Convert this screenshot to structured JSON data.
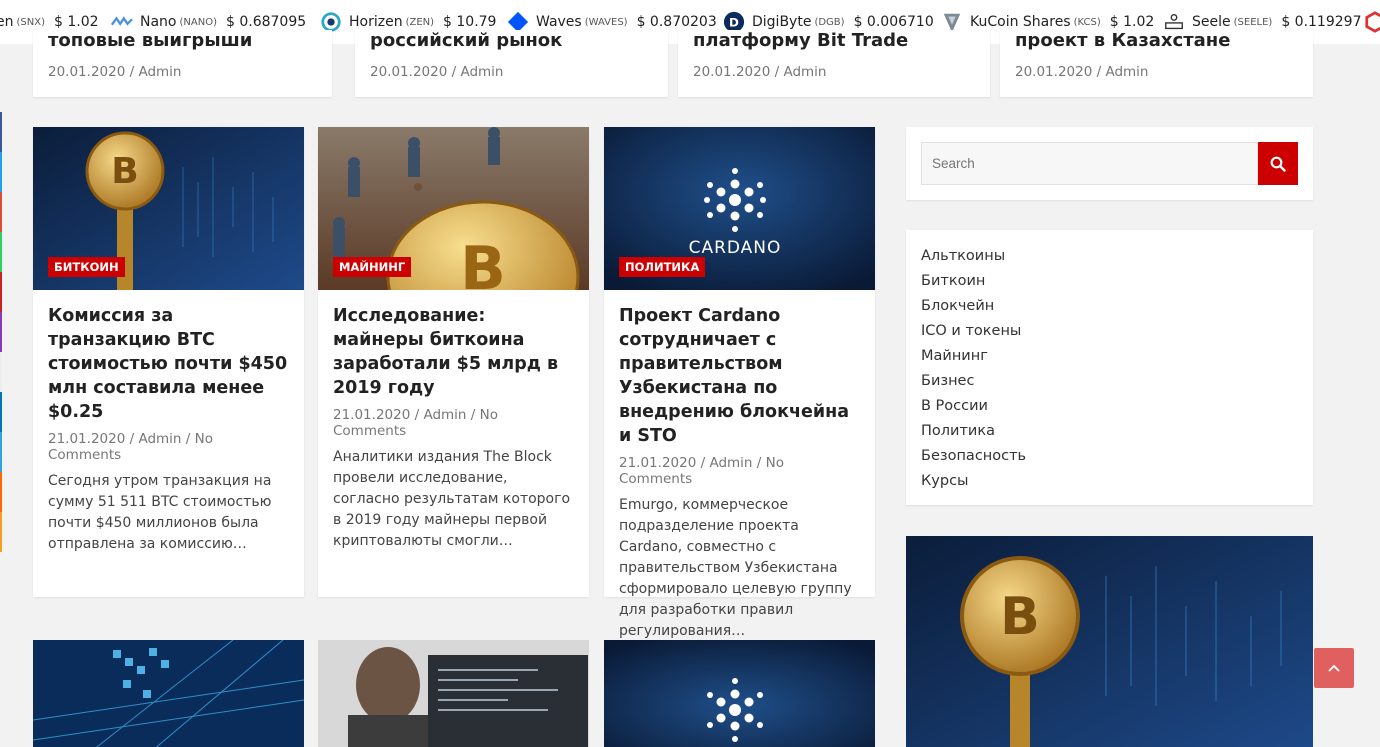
{
  "ticker": [
    {
      "name": "en",
      "symbol": "(SNX)",
      "price": "$ 1.02",
      "icon": "synthetix-icon"
    },
    {
      "name": "Nano",
      "symbol": "(NANO)",
      "price": "$ 0.687095",
      "icon": "nano-icon"
    },
    {
      "name": "Horizen",
      "symbol": "(ZEN)",
      "price": "$ 10.79",
      "icon": "horizen-icon"
    },
    {
      "name": "Waves",
      "symbol": "(WAVES)",
      "price": "$ 0.870203",
      "icon": "waves-icon"
    },
    {
      "name": "DigiByte",
      "symbol": "(DGB)",
      "price": "$ 0.006710",
      "icon": "digibyte-icon"
    },
    {
      "name": "KuCoin Shares",
      "symbol": "(KCS)",
      "price": "$ 1.02",
      "icon": "kucoin-icon"
    },
    {
      "name": "Seele",
      "symbol": "(SEELE)",
      "price": "$ 0.119297",
      "icon": "seele-icon"
    }
  ],
  "top_cards": [
    {
      "title": "топовые выигрыши",
      "date": "20.01.2020",
      "author": "Admin"
    },
    {
      "title": "российский рынок",
      "date": "20.01.2020",
      "author": "Admin"
    },
    {
      "title": "платформу Bit Trade",
      "date": "20.01.2020",
      "author": "Admin"
    },
    {
      "title": "проект в Казахстане",
      "date": "20.01.2020",
      "author": "Admin"
    }
  ],
  "meta_sep": "/",
  "articles": [
    {
      "category": "Биткоин",
      "title": "Комиссия за транзакцию BTC стоимостью почти $450 млн составила менее $0.25",
      "date": "21.01.2020",
      "author": "Admin",
      "comments": "No Comments",
      "excerpt": "Сегодня утром транзакция на сумму 51 511 BTC стоимостью почти $450 миллионов была отправлена за комиссию…"
    },
    {
      "category": "Майнинг",
      "title": "Исследование: майнеры биткоина заработали $5 млрд в 2019 году",
      "date": "21.01.2020",
      "author": "Admin",
      "comments": "No Comments",
      "excerpt": "Аналитики издания The Block провели исследование, согласно результатам которого в 2019 году майнеры первой криптовалюты смогли…"
    },
    {
      "category": "Политика",
      "title": "Проект Cardano сотрудничает с правительством Узбекистана по внедрению блокчейна и STO",
      "date": "21.01.2020",
      "author": "Admin",
      "comments": "No Comments",
      "excerpt": "Emurgo, коммерческое подразделение проекта Cardano, совместно с правительством Узбекистана сформировало целевую группу для разработки правил регулирования…"
    }
  ],
  "cardano_logo_text": "CARDANO",
  "search": {
    "placeholder": "Search"
  },
  "categories": [
    "Альткоины",
    "Биткоин",
    "Блокчейн",
    "ICO и токены",
    "Майнинг",
    "Бизнес",
    "В России",
    "Политика",
    "Безопасность",
    "Курсы"
  ],
  "colors": {
    "accent": "#cc0000",
    "scroll_top": "#e06060"
  }
}
